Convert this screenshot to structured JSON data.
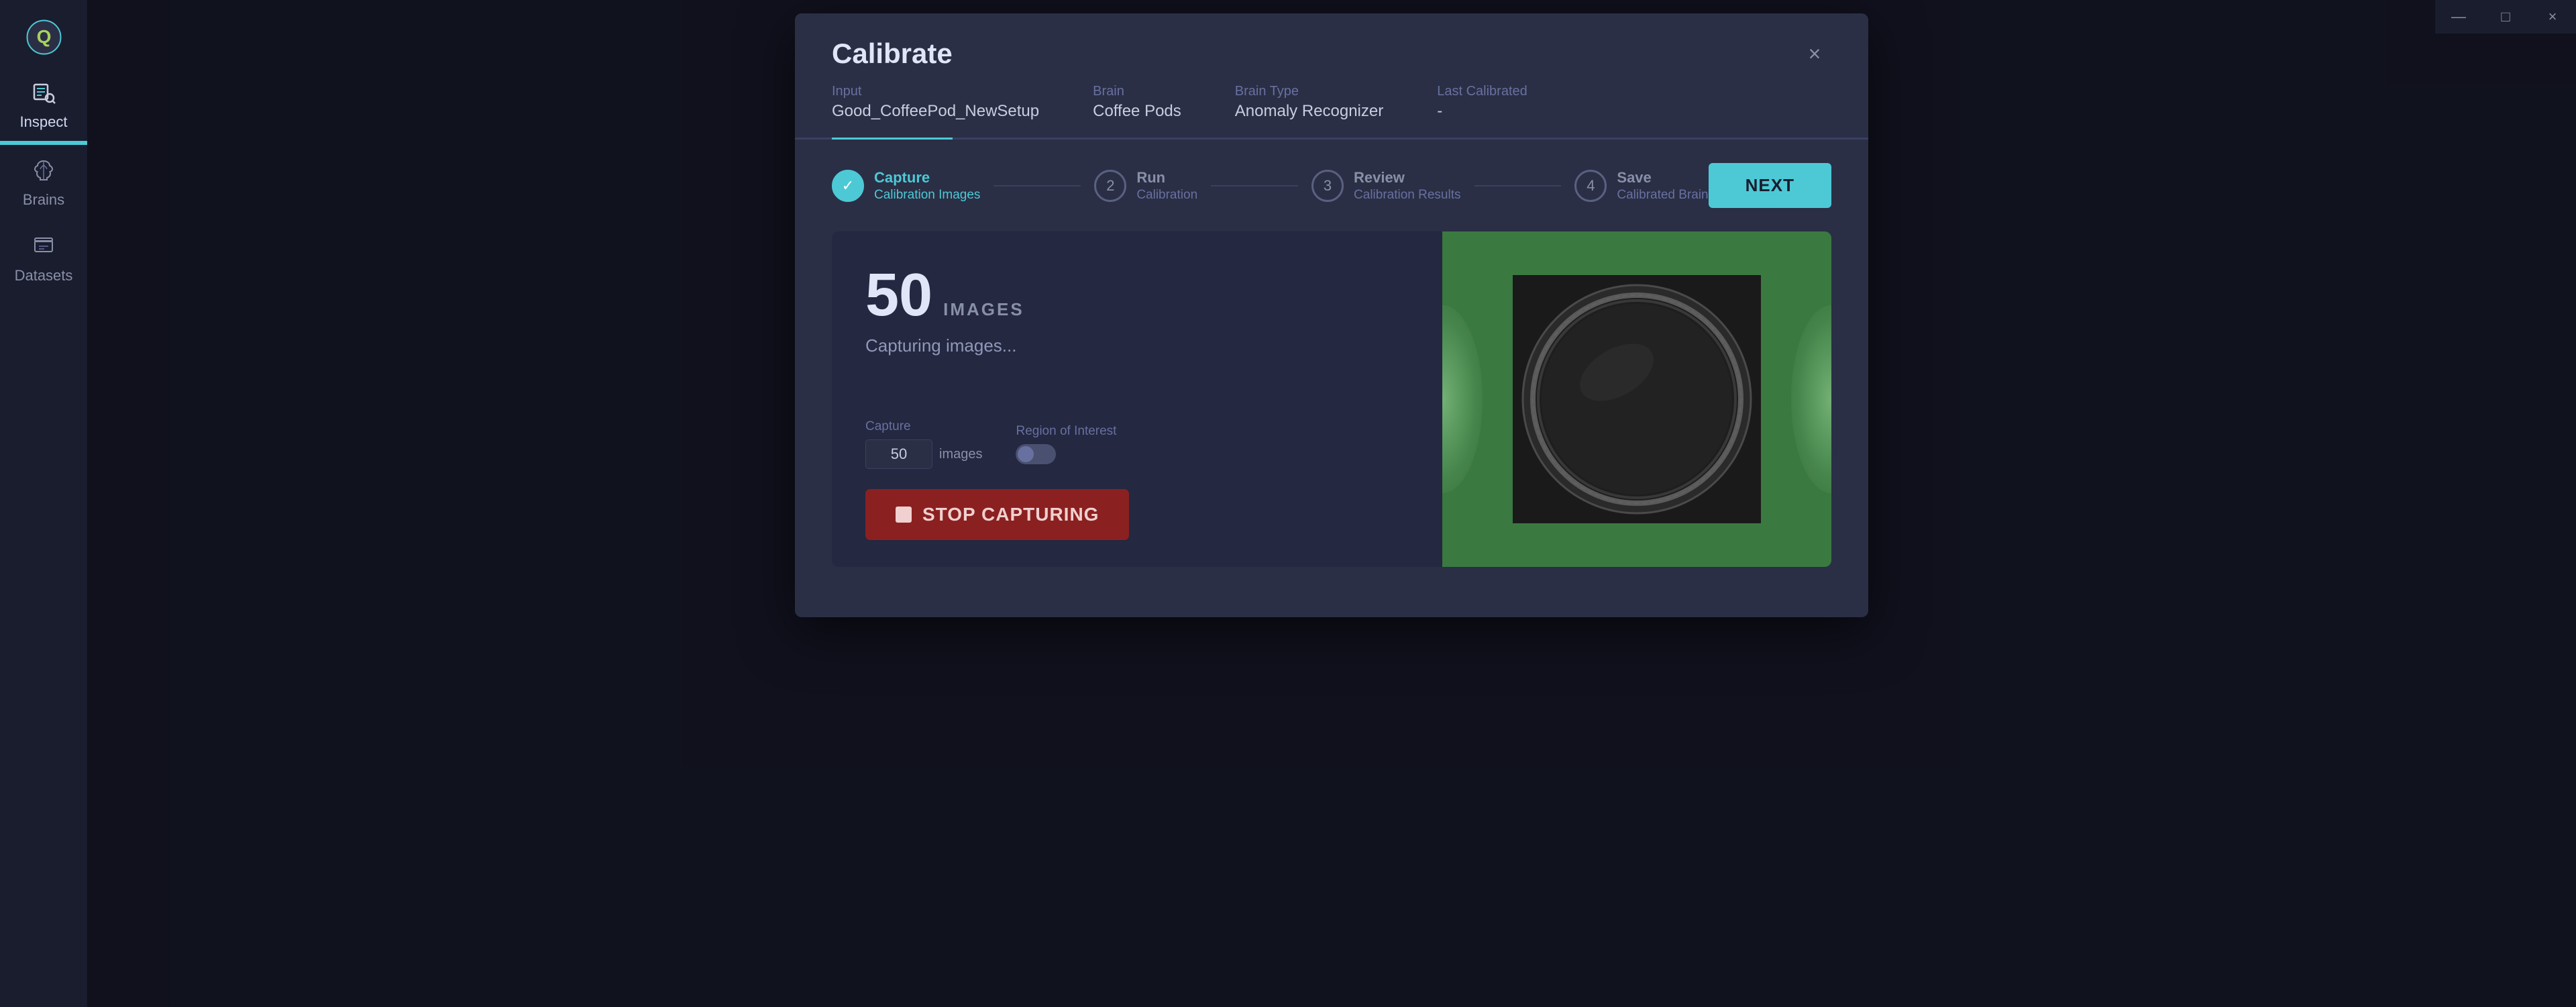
{
  "app": {
    "title": "Calibrate",
    "logo_icon": "Q"
  },
  "window_controls": {
    "minimize": "—",
    "maximize": "□",
    "close": "×"
  },
  "sidebar": {
    "items": [
      {
        "id": "inspect",
        "label": "Inspect",
        "active": true
      },
      {
        "id": "brains",
        "label": "Brains",
        "active": false
      },
      {
        "id": "datasets",
        "label": "Datasets",
        "active": false
      }
    ]
  },
  "modal": {
    "title": "Calibrate",
    "close_label": "×",
    "info": {
      "input_label": "Input",
      "input_value": "Good_CoffeePod_NewSetup",
      "brain_label": "Brain",
      "brain_value": "Coffee Pods",
      "brain_type_label": "Brain Type",
      "brain_type_value": "Anomaly Recognizer",
      "last_calibrated_label": "Last Calibrated",
      "last_calibrated_value": "-"
    },
    "steps": [
      {
        "num": "✓",
        "name": "Capture",
        "desc": "Calibration Images",
        "state": "completed"
      },
      {
        "num": "2",
        "name": "Run",
        "desc": "Calibration",
        "state": "inactive"
      },
      {
        "num": "3",
        "name": "Review",
        "desc": "Calibration Results",
        "state": "inactive"
      },
      {
        "num": "4",
        "name": "Save",
        "desc": "Calibrated Brain",
        "state": "inactive"
      }
    ],
    "next_button": "NEXT",
    "capture": {
      "image_count": "50",
      "image_count_label": "IMAGES",
      "status": "Capturing images...",
      "capture_label": "Capture",
      "capture_value": "50",
      "capture_suffix": "images",
      "roi_label": "Region of Interest",
      "stop_button": "STOP CAPTURING"
    }
  }
}
